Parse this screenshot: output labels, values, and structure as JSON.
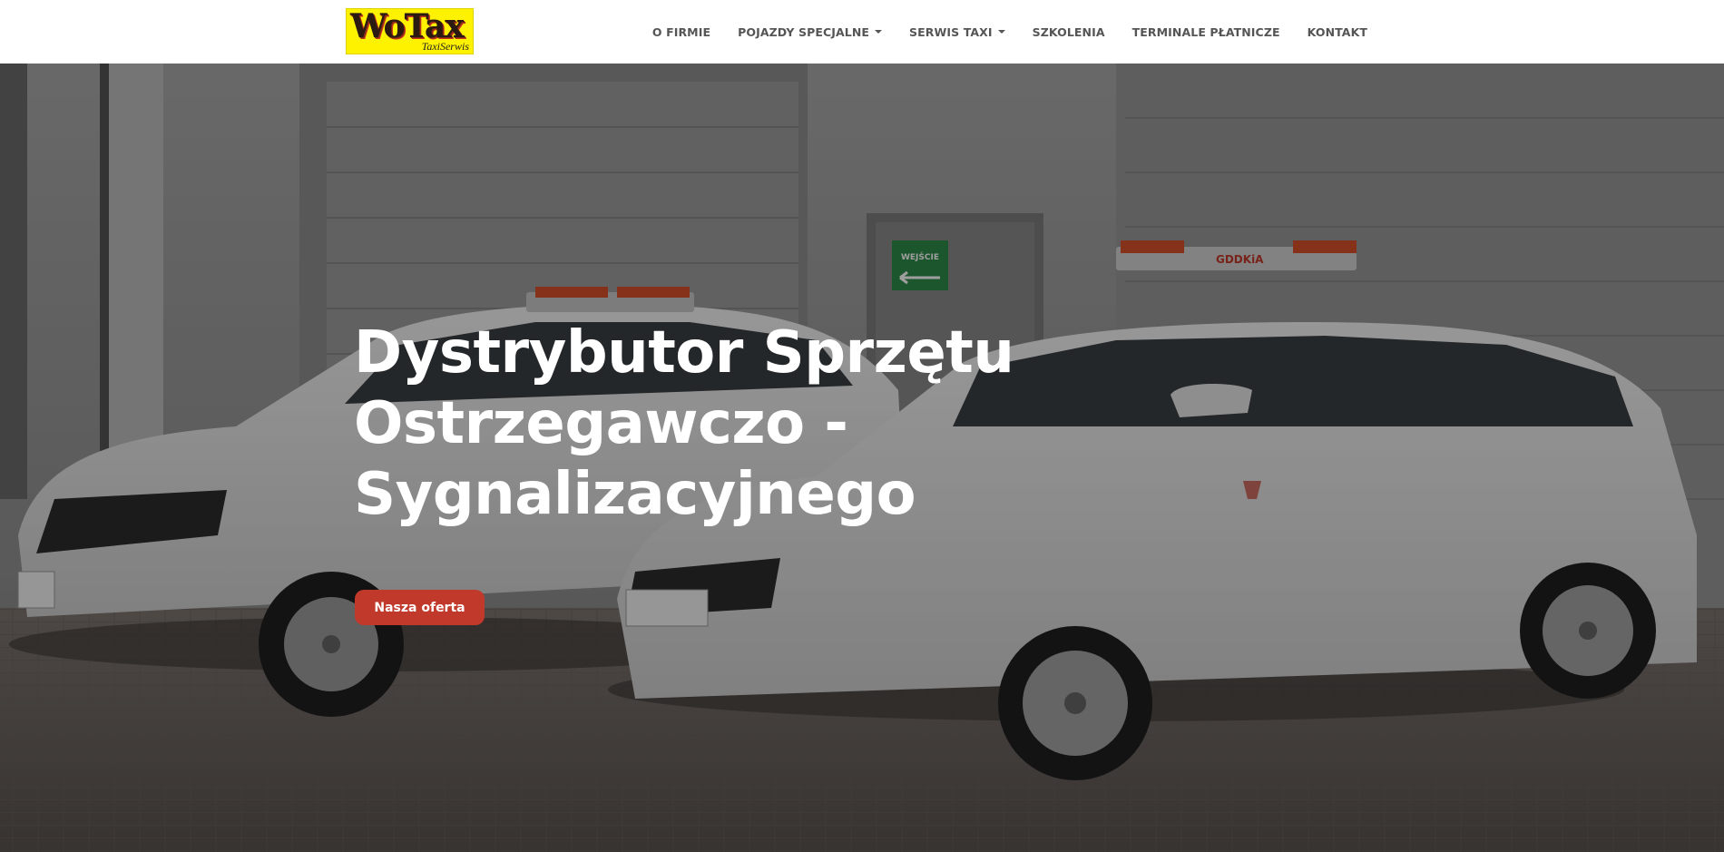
{
  "logo": {
    "main": "WoTax",
    "sub": "TaxiSerwis"
  },
  "nav": {
    "items": [
      {
        "label": "O FIRMIE",
        "dropdown": false
      },
      {
        "label": "POJAZDY SPECJALNE",
        "dropdown": true
      },
      {
        "label": "SERWIS TAXI",
        "dropdown": true
      },
      {
        "label": "SZKOLENIA",
        "dropdown": false
      },
      {
        "label": "TERMINALE PŁATNICZE",
        "dropdown": false
      },
      {
        "label": "KONTAKT",
        "dropdown": false
      }
    ]
  },
  "hero": {
    "title_line1": "Dystrybutor Sprzętu",
    "title_line2": "Ostrzegawczo -",
    "title_line3": "Sygnalizacyjnego",
    "button_label": "Nasza oferta",
    "sign_text": "WEJŚCIE",
    "lightbar_text": "GDDKiA"
  },
  "colors": {
    "accent": "#c0392b",
    "logo_bg": "#fff200",
    "nav_text": "#555555"
  }
}
